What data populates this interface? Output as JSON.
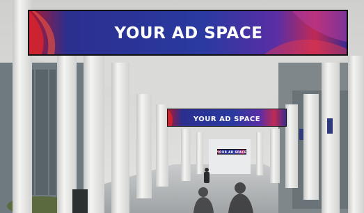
{
  "scene": {
    "subject": "covered walkway corridor with hanging LED advertising displays",
    "ad_text": "YOUR AD SPACE",
    "colors": {
      "ceiling": "#d6d6d4",
      "pillar": "#eeeeec",
      "floor": "#b9bcbe",
      "glass": "#8a9296",
      "ad_blue": "#2a3aa0",
      "ad_red": "#d6242f",
      "ad_purple": "#7a2fa8"
    }
  }
}
